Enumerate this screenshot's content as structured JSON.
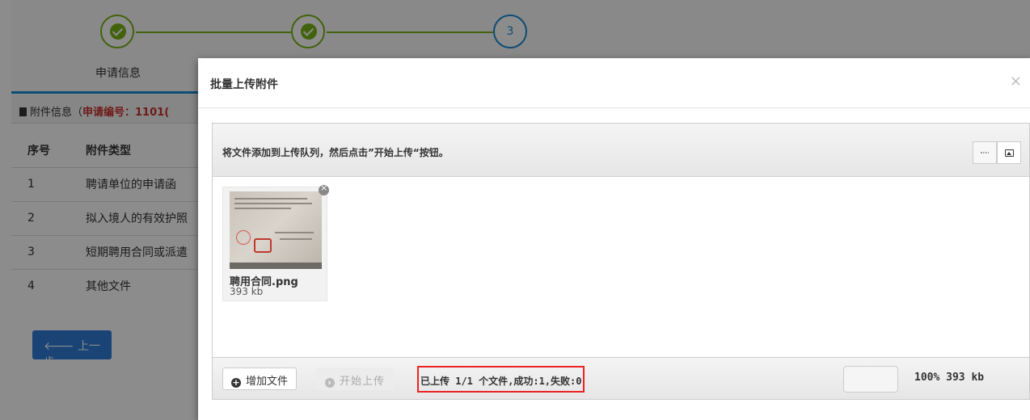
{
  "steps": {
    "items": [
      {
        "label": "申请信息",
        "status": "done"
      },
      {
        "label": "",
        "status": "done"
      },
      {
        "label": "",
        "number": "3",
        "status": "current"
      }
    ]
  },
  "attachment_panel": {
    "title": "附件信息（",
    "app_no_label": "申请编号：1101(",
    "columns": [
      "序号",
      "附件类型"
    ],
    "rows": [
      {
        "no": "1",
        "type": "聘请单位的申请函"
      },
      {
        "no": "2",
        "type": "拟入境人的有效护照"
      },
      {
        "no": "3",
        "type": "短期聘用合同或派遣"
      },
      {
        "no": "4",
        "type": "其他文件"
      }
    ],
    "prev_button": "上一步"
  },
  "modal": {
    "title": "批量上传附件",
    "close": "×",
    "instruction": "将文件添加到上传队列，然后点击”开始上传“按钮。",
    "files": [
      {
        "name": "聘用合同.png",
        "size": "393 kb"
      }
    ],
    "add_button": "增加文件",
    "start_button": "开始上传",
    "status_text": "已上传 1/1 个文件,成功:1,失败:0",
    "total_progress": "100%",
    "total_size": "393 kb",
    "total_text": "100% 393 kb",
    "progress_fraction": 1.0
  },
  "colors": {
    "step_done": "#7ab317",
    "step_current": "#1a8bd1",
    "highlight_border": "#e22222",
    "prev_button": "#2f7cd6"
  }
}
